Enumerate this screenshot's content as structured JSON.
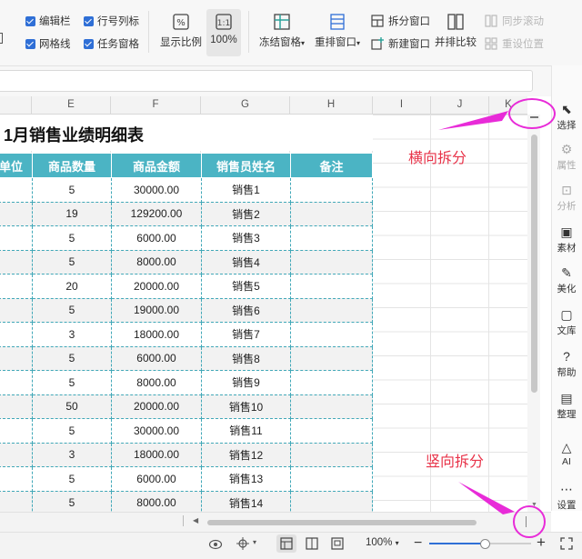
{
  "ribbon": {
    "checkboxes": [
      {
        "label": "编辑栏"
      },
      {
        "label": "行号列标"
      },
      {
        "label": "网格线"
      },
      {
        "label": "任务窗格"
      }
    ],
    "zoom_ratio_label": "显示比例",
    "zoom_100_label": "100%",
    "freeze_label": "冻结窗格",
    "rearrange_label": "重排窗口",
    "split_window_label": "拆分窗口",
    "new_window_label": "新建窗口",
    "side_by_side_label": "并排比较",
    "sync_scroll_label": "同步滚动",
    "reset_position_label": "重设位置"
  },
  "columns": [
    "E",
    "F",
    "G",
    "H",
    "I",
    "J",
    "K"
  ],
  "sheet": {
    "title": "1月销售业绩明细表",
    "headers": [
      "单位",
      "商品数量",
      "商品金额",
      "销售员姓名",
      "备注"
    ],
    "rows": [
      {
        "qty": "5",
        "amount": "30000.00",
        "seller": "销售1"
      },
      {
        "qty": "19",
        "amount": "129200.00",
        "seller": "销售2"
      },
      {
        "qty": "5",
        "amount": "6000.00",
        "seller": "销售3"
      },
      {
        "qty": "5",
        "amount": "8000.00",
        "seller": "销售4"
      },
      {
        "qty": "20",
        "amount": "20000.00",
        "seller": "销售5"
      },
      {
        "qty": "5",
        "amount": "19000.00",
        "seller": "销售6"
      },
      {
        "qty": "3",
        "amount": "18000.00",
        "seller": "销售7"
      },
      {
        "qty": "5",
        "amount": "6000.00",
        "seller": "销售8"
      },
      {
        "qty": "5",
        "amount": "8000.00",
        "seller": "销售9"
      },
      {
        "qty": "50",
        "amount": "20000.00",
        "seller": "销售10"
      },
      {
        "qty": "5",
        "amount": "30000.00",
        "seller": "销售11"
      },
      {
        "qty": "3",
        "amount": "18000.00",
        "seller": "销售12"
      },
      {
        "qty": "5",
        "amount": "6000.00",
        "seller": "销售13"
      },
      {
        "qty": "5",
        "amount": "8000.00",
        "seller": "销售14"
      }
    ]
  },
  "panel": [
    {
      "label": "选择",
      "icon": "cursor-icon"
    },
    {
      "label": "属性",
      "icon": "properties-icon"
    },
    {
      "label": "分析",
      "icon": "analysis-icon"
    },
    {
      "label": "素材",
      "icon": "material-icon"
    },
    {
      "label": "美化",
      "icon": "beautify-icon"
    },
    {
      "label": "文库",
      "icon": "library-icon"
    },
    {
      "label": "帮助",
      "icon": "help-icon"
    },
    {
      "label": "整理",
      "icon": "organize-icon"
    },
    {
      "label": "AI",
      "icon": "ai-icon"
    },
    {
      "label": "设置",
      "icon": "settings-icon"
    }
  ],
  "annotations": {
    "horizontal_split": "横向拆分",
    "vertical_split": "竖向拆分"
  },
  "status": {
    "zoom": "100%"
  },
  "colors": {
    "header_fill": "#4bb4c4",
    "annotation_red": "#e8344a",
    "arrow_magenta": "#e82bd8",
    "checkbox_blue": "#2f6fd6"
  }
}
